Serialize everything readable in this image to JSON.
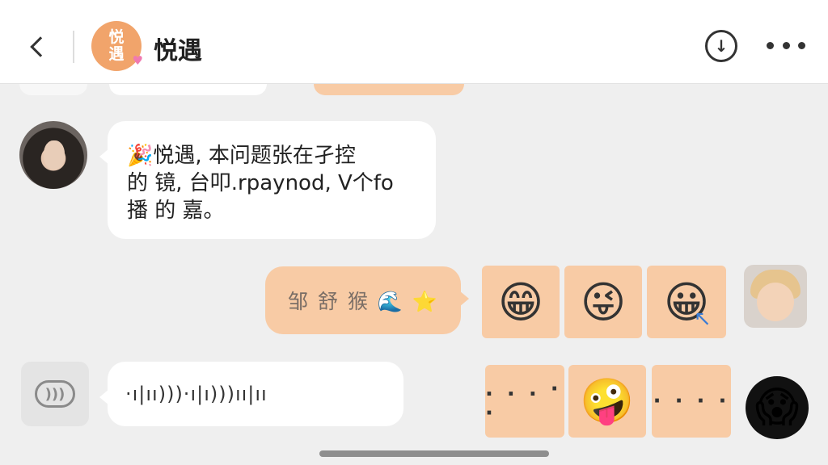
{
  "header": {
    "logo_line1": "悦",
    "logo_line2": "遇",
    "logo_heart": "♥",
    "title": "悦遇",
    "download_glyph": "↓"
  },
  "messages": {
    "incoming_text": {
      "lines": [
        "🎉悦遇, 本问题张在孑控",
        "的 镜, 台叩.rpaynod, V个fo",
        "播 的 嘉。"
      ]
    },
    "outgoing_text": "邹 舒 猴 🌊 ⭐",
    "voice": {
      "waveform": "·ı|ıı)))·ı|ı)))ıı|ıı"
    }
  },
  "stickers": {
    "row1": [
      "😁",
      "😜",
      "😀"
    ],
    "row2": [
      ". . .  ·  ·",
      "🤪",
      "·  ·  ·  ·"
    ],
    "shock_avatar": "😱",
    "cursor": "↖"
  },
  "colors": {
    "accent": "#f1a46b",
    "bubble_peach": "#f8cba5",
    "background": "#efefef"
  }
}
